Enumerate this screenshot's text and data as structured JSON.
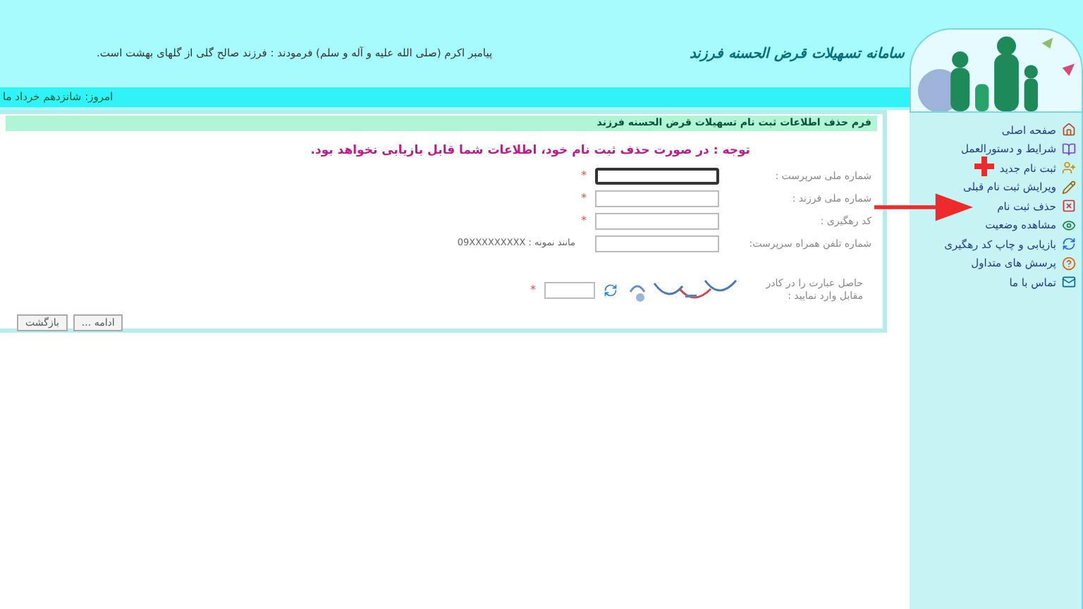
{
  "header": {
    "logo_text": "سامانه تسهیلات قرض الحسنه فرزند",
    "quote": "پیامبر اکرم (صلی الله علیه و آله و سلم) فرمودند : فرزند صالح گلی از گلهای بهشت است.",
    "date": "امروز: شانزدهم خرداد ما"
  },
  "form": {
    "title": "فرم حذف اطلاعات ثبت نام تسهیلات قرض الحسنه فرزند",
    "notice": "توجه : در صورت حذف ثبت نام خود، اطلاعات شما قابل بازیابی نخواهد بود.",
    "fields": [
      {
        "label": "شماره ملی سرپرست :",
        "required_mark": "*",
        "focused": true
      },
      {
        "label": "شماره ملی فرزند :",
        "required_mark": "*",
        "focused": false
      },
      {
        "label": "کد رهگیری :",
        "required_mark": "*",
        "focused": false
      },
      {
        "label": "شماره تلفن همراه سرپرست:",
        "focused": false,
        "hint": "مانند نمونه : 09XXXXXXXXX"
      }
    ],
    "captcha": {
      "label": "حاصل عبارت را در کادر مقابل وارد نمایید :",
      "required_mark": "*"
    },
    "buttons": [
      "ادامه ...",
      "بازگشت"
    ]
  },
  "sidebar": {
    "items": [
      {
        "label": "صفحه اصلی",
        "kind": "home"
      },
      {
        "label": "شرایط و دستورالعمل",
        "kind": "book"
      },
      {
        "label": "ثبت نام جدید",
        "kind": "new"
      },
      {
        "label": "ویرایش ثبت نام قبلی",
        "kind": "edit"
      },
      {
        "label": "حذف ثبت نام",
        "kind": "delete"
      },
      {
        "label": "مشاهده وضعیت",
        "kind": "view"
      },
      {
        "label": "بازیابی و چاپ کد رهگیری",
        "kind": "refresh"
      },
      {
        "label": "پرسش های متداول",
        "kind": "faq"
      },
      {
        "label": "تماس با ما",
        "kind": "contact"
      }
    ]
  }
}
